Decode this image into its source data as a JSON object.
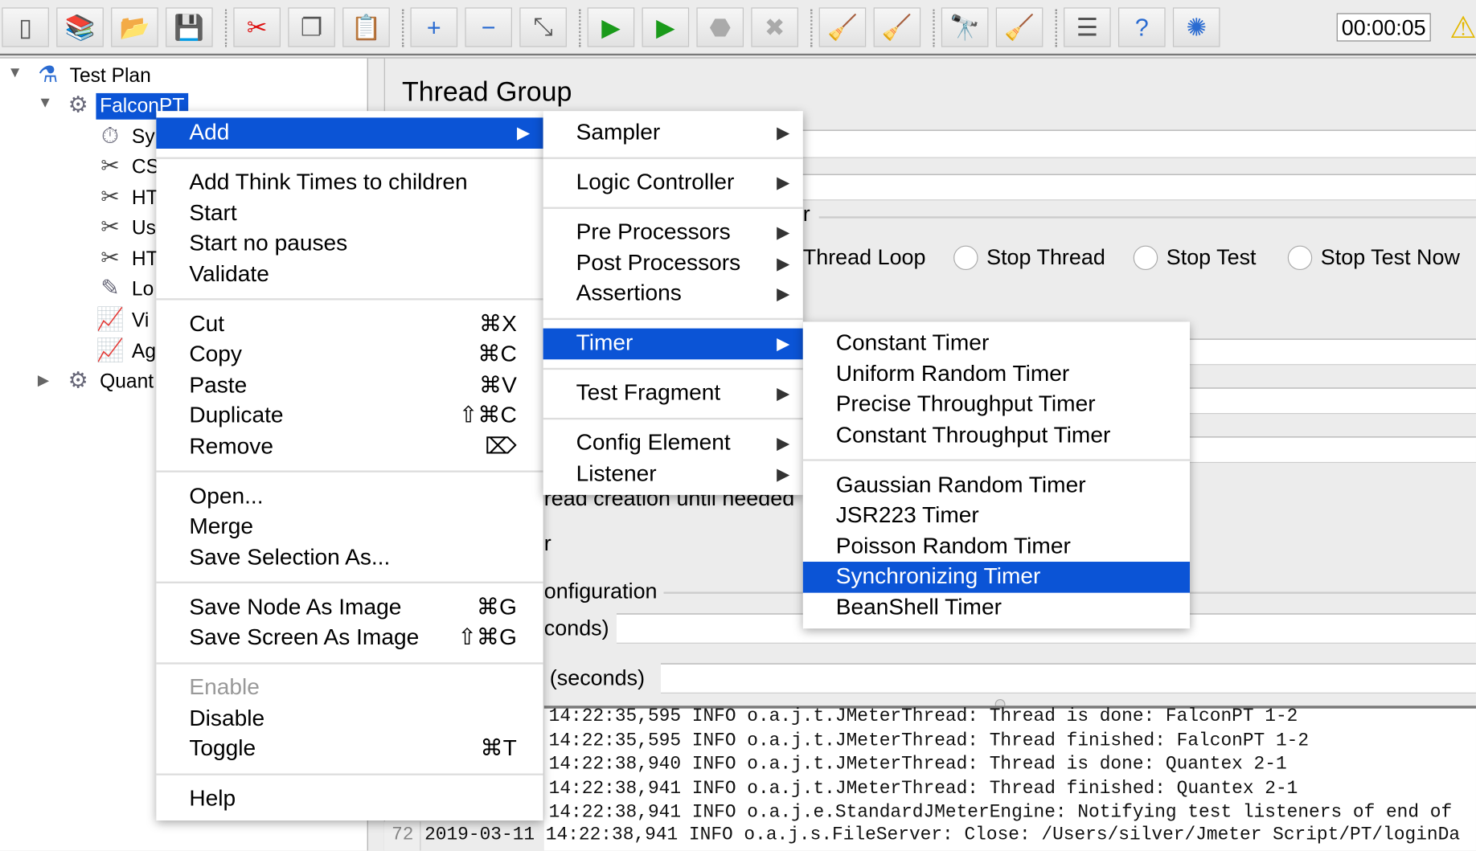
{
  "toolbar": {
    "buttons": [
      "new-icon",
      "templates-icon",
      "open-icon",
      "save-icon",
      "|",
      "cut-icon",
      "copy-icon",
      "paste-icon",
      "|",
      "expand-icon",
      "collapse-icon",
      "toggle-icon",
      "|",
      "start-icon",
      "start-no-pauses-icon",
      "stop-icon",
      "shutdown-icon",
      "|",
      "clear-icon",
      "clear-all-icon",
      "|",
      "search-icon",
      "reset-search-icon",
      "|",
      "function-helper-icon",
      "help-icon",
      "remote-icon"
    ],
    "elapsed": "00:00:05",
    "warning_icon": "⚠"
  },
  "tree": {
    "items": [
      {
        "label": "Test Plan",
        "icon": "flask-icon",
        "glyph": "⚗",
        "expanded": true
      },
      {
        "label": "FalconPT",
        "icon": "thread-group-icon",
        "glyph": "⚙",
        "expanded": true,
        "selected": true
      },
      {
        "label": "Sy",
        "icon": "timer-icon",
        "glyph": "⏱"
      },
      {
        "label": "CS",
        "icon": "config-icon",
        "glyph": "✂"
      },
      {
        "label": "HT",
        "icon": "config-icon",
        "glyph": "✂"
      },
      {
        "label": "Us",
        "icon": "config-icon",
        "glyph": "✂"
      },
      {
        "label": "HT",
        "icon": "config-icon",
        "glyph": "✂"
      },
      {
        "label": "Lo",
        "icon": "sampler-icon",
        "glyph": "✎"
      },
      {
        "label": "Vi",
        "icon": "listener-icon",
        "glyph": "📈"
      },
      {
        "label": "Ag",
        "icon": "listener-icon",
        "glyph": "📈"
      },
      {
        "label": "Quant",
        "icon": "thread-group-icon",
        "glyph": "⚙",
        "expanded": false
      }
    ]
  },
  "main": {
    "title": "Thread Group",
    "error_action_fragment": "r",
    "radios": [
      "Thread Loop",
      "Stop Thread",
      "Stop Test",
      "Stop Test Now"
    ],
    "delay_fragment": "read creation until needed",
    "scheduler_fragment": "r",
    "scheduler_config_fragment": "onfiguration",
    "duration_fragment": "conds)",
    "startup_delay_fragment": "(seconds)"
  },
  "log": {
    "lines": [
      "14:22:35,595 INFO o.a.j.t.JMeterThread: Thread is done: FalconPT 1-2",
      "14:22:35,595 INFO o.a.j.t.JMeterThread: Thread finished: FalconPT 1-2",
      "14:22:38,940 INFO o.a.j.t.JMeterThread: Thread is done: Quantex 2-1",
      "14:22:38,941 INFO o.a.j.t.JMeterThread: Thread finished: Quantex 2-1",
      "14:22:38,941 INFO o.a.j.e.StandardJMeterEngine: Notifying test listeners of end of"
    ],
    "last_line_number": "72",
    "last_line": "2019-03-11 14:22:38,941 INFO o.a.j.s.FileServer: Close: /Users/silver/Jmeter Script/PT/loginDa"
  },
  "context_menu": [
    {
      "label": "Add",
      "submenu": true,
      "highlighted": true
    },
    {
      "sep": true
    },
    {
      "label": "Add Think Times to children"
    },
    {
      "label": "Start"
    },
    {
      "label": "Start no pauses"
    },
    {
      "label": "Validate"
    },
    {
      "sep": true
    },
    {
      "label": "Cut",
      "shortcut": "⌘X"
    },
    {
      "label": "Copy",
      "shortcut": "⌘C"
    },
    {
      "label": "Paste",
      "shortcut": "⌘V"
    },
    {
      "label": "Duplicate",
      "shortcut": "⇧⌘C"
    },
    {
      "label": "Remove",
      "shortcut": "⌦"
    },
    {
      "sep": true
    },
    {
      "label": "Open..."
    },
    {
      "label": "Merge"
    },
    {
      "label": "Save Selection As..."
    },
    {
      "sep": true
    },
    {
      "label": "Save Node As Image",
      "shortcut": "⌘G"
    },
    {
      "label": "Save Screen As Image",
      "shortcut": "⇧⌘G"
    },
    {
      "sep": true
    },
    {
      "label": "Enable",
      "disabled": true
    },
    {
      "label": "Disable"
    },
    {
      "label": "Toggle",
      "shortcut": "⌘T"
    },
    {
      "sep": true
    },
    {
      "label": "Help"
    }
  ],
  "add_submenu": [
    {
      "label": "Sampler",
      "submenu": true
    },
    {
      "sep": true
    },
    {
      "label": "Logic Controller",
      "submenu": true
    },
    {
      "sep": true
    },
    {
      "label": "Pre Processors",
      "submenu": true
    },
    {
      "label": "Post Processors",
      "submenu": true
    },
    {
      "label": "Assertions",
      "submenu": true
    },
    {
      "sep": true
    },
    {
      "label": "Timer",
      "submenu": true,
      "highlighted": true
    },
    {
      "sep": true
    },
    {
      "label": "Test Fragment",
      "submenu": true
    },
    {
      "sep": true
    },
    {
      "label": "Config Element",
      "submenu": true
    },
    {
      "label": "Listener",
      "submenu": true
    }
  ],
  "timer_submenu": [
    {
      "label": "Constant Timer"
    },
    {
      "label": "Uniform Random Timer"
    },
    {
      "label": "Precise Throughput Timer"
    },
    {
      "label": "Constant Throughput Timer"
    },
    {
      "sep": true
    },
    {
      "label": "Gaussian Random Timer"
    },
    {
      "label": "JSR223 Timer"
    },
    {
      "label": "Poisson Random Timer"
    },
    {
      "label": "Synchronizing Timer",
      "highlighted": true
    },
    {
      "label": "BeanShell Timer"
    }
  ],
  "colors": {
    "selection": "#0b54d6",
    "panel": "#ececec"
  }
}
